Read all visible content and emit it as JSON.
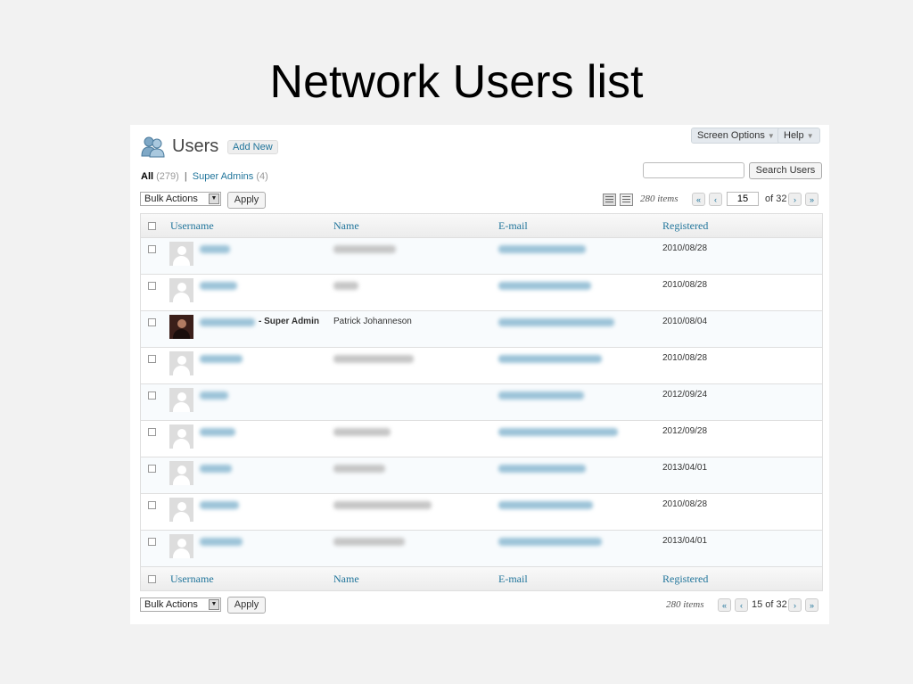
{
  "slide_title": "Network Users list",
  "header": {
    "title": "Users",
    "add_new": "Add New",
    "screen_options": "Screen Options",
    "help": "Help",
    "dropdown_glyph": "▼"
  },
  "filters": {
    "all_label": "All",
    "all_count": "(279)",
    "separator": "|",
    "super_admins_label": "Super Admins",
    "super_admins_count": "(4)"
  },
  "search": {
    "button": "Search Users",
    "value": ""
  },
  "bulk": {
    "selected": "Bulk Actions",
    "apply": "Apply"
  },
  "pagination_top": {
    "items": "280 items",
    "first": "«",
    "prev": "‹",
    "next": "›",
    "last": "»",
    "current_page": "15",
    "of": "of 32"
  },
  "pagination_bottom": {
    "items": "280 items",
    "first": "«",
    "prev": "‹",
    "next": "›",
    "last": "»",
    "page_of": "15 of 32"
  },
  "columns": [
    "Username",
    "Name",
    "E-mail",
    "Registered"
  ],
  "rows": [
    {
      "registered": "2010/08/28",
      "avatar": "default"
    },
    {
      "registered": "2010/08/28",
      "avatar": "default"
    },
    {
      "registered": "2010/08/04",
      "avatar": "photo",
      "role": "- Super Admin",
      "name": "Patrick Johanneson"
    },
    {
      "registered": "2010/08/28",
      "avatar": "default"
    },
    {
      "registered": "2012/09/24",
      "avatar": "default"
    },
    {
      "registered": "2012/09/28",
      "avatar": "default"
    },
    {
      "registered": "2013/04/01",
      "avatar": "default"
    },
    {
      "registered": "2010/08/28",
      "avatar": "default"
    },
    {
      "registered": "2013/04/01",
      "avatar": "default"
    }
  ],
  "colors": {
    "link": "#21759b",
    "header_bg": "#ececec"
  }
}
